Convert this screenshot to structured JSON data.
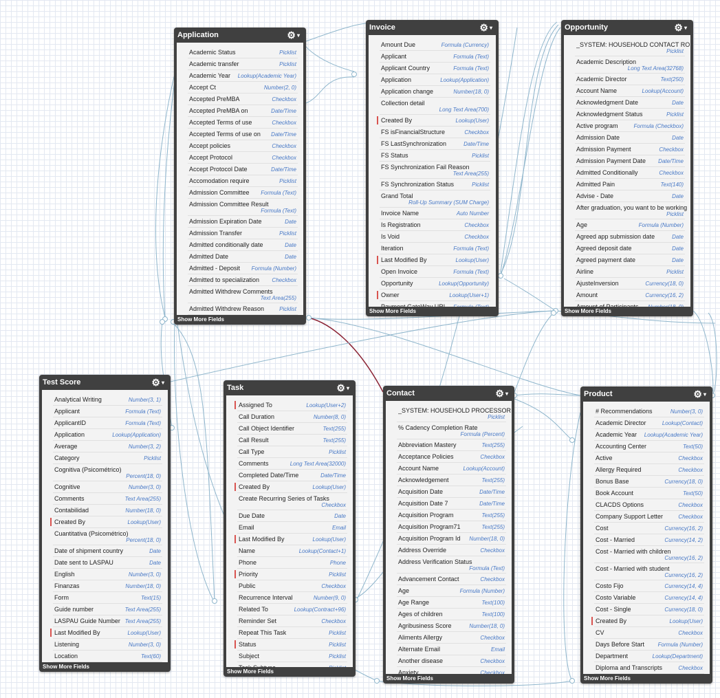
{
  "ui": {
    "gear_glyph": "⚙",
    "caret_glyph": "▾",
    "show_more": "Show More Fields"
  },
  "colors": {
    "header": "#404040",
    "body": "#f3f3f3",
    "field_type": "#4778c6",
    "lookup_marker": "#d9534f",
    "relation_line": "#8fb6cc",
    "master_detail_line": "#8a2233"
  },
  "objects": [
    {
      "id": "application",
      "title": "Application",
      "fields": [
        {
          "name": "Academic Status",
          "type": "Picklist"
        },
        {
          "name": "Academic transfer",
          "type": "Picklist"
        },
        {
          "name": "Academic Year",
          "type": "Lookup(Academic Year)"
        },
        {
          "name": "Accept Ct",
          "type": "Number(2, 0)"
        },
        {
          "name": "Accepted PreMBA",
          "type": "Checkbox"
        },
        {
          "name": "Accepted PreMBA on",
          "type": "Date/Time"
        },
        {
          "name": "Accepted Terms of use",
          "type": "Checkbox"
        },
        {
          "name": "Accepted Terms of use on",
          "type": "Date/Time"
        },
        {
          "name": "Accept policies",
          "type": "Checkbox"
        },
        {
          "name": "Accept Protocol",
          "type": "Checkbox"
        },
        {
          "name": "Accept Protocol Date",
          "type": "Date/Time"
        },
        {
          "name": "Accomodation require",
          "type": "Picklist"
        },
        {
          "name": "Admission Committee",
          "type": "Formula (Text)"
        },
        {
          "name": "Admission Committee Result",
          "type": "Formula (Text)",
          "wrap": true
        },
        {
          "name": "Admission Expiration Date",
          "type": "Date"
        },
        {
          "name": "Admission Transfer",
          "type": "Picklist"
        },
        {
          "name": "Admitted conditionally date",
          "type": "Date"
        },
        {
          "name": "Admitted Date",
          "type": "Date"
        },
        {
          "name": "Admitted - Deposit",
          "type": "Formula (Number)"
        },
        {
          "name": "Admitted to specialization",
          "type": "Checkbox"
        },
        {
          "name": "Admitted Withdrew Comments",
          "type": "Text Area(255)",
          "wrap": true
        },
        {
          "name": "Admitted Withdrew Reason",
          "type": "Picklist"
        }
      ]
    },
    {
      "id": "invoice",
      "title": "Invoice",
      "fields": [
        {
          "name": "Amount Due",
          "type": "Formula (Currency)"
        },
        {
          "name": "Applicant",
          "type": "Formula (Text)"
        },
        {
          "name": "Applicant Country",
          "type": "Formula (Text)"
        },
        {
          "name": "Application",
          "type": "Lookup(Application)"
        },
        {
          "name": "Application change",
          "type": "Number(18, 0)"
        },
        {
          "name": "Collection detail",
          "type": "Long Text Area(700)",
          "wrap": true
        },
        {
          "name": "Created By",
          "type": "Lookup(User)",
          "lookup": true
        },
        {
          "name": "FS isFinancialStructure",
          "type": "Checkbox"
        },
        {
          "name": "FS LastSynchronization",
          "type": "Date/Time"
        },
        {
          "name": "FS Status",
          "type": "Picklist"
        },
        {
          "name": "FS Synchronization Fail Reason",
          "type": "Text Area(255)",
          "wrap": true
        },
        {
          "name": "FS Synchronization Status",
          "type": "Picklist"
        },
        {
          "name": "Grand Total",
          "type": "Roll-Up Summary (SUM Charge)",
          "wrap": true
        },
        {
          "name": "Invoice Name",
          "type": "Auto Number"
        },
        {
          "name": "Is Registration",
          "type": "Checkbox"
        },
        {
          "name": "Is Void",
          "type": "Checkbox"
        },
        {
          "name": "Iteration",
          "type": "Formula (Text)"
        },
        {
          "name": "Last Modified By",
          "type": "Lookup(User)",
          "lookup": true
        },
        {
          "name": "Open Invoice",
          "type": "Formula (Text)"
        },
        {
          "name": "Opportunity",
          "type": "Lookup(Opportunity)"
        },
        {
          "name": "Owner",
          "type": "Lookup(User+1)",
          "lookup": true
        },
        {
          "name": "Payment GateWay URL",
          "type": "Formula (Text)"
        }
      ]
    },
    {
      "id": "opportunity",
      "title": "Opportunity",
      "fields": [
        {
          "name": "_SYSTEM: HOUSEHOLD CONTACT RO",
          "type": "Picklist",
          "wrap": true
        },
        {
          "name": "Academic Description",
          "type": "Long Text Area(32768)",
          "wrap": true
        },
        {
          "name": "Academic Director",
          "type": "Text(250)"
        },
        {
          "name": "Account Name",
          "type": "Lookup(Account)"
        },
        {
          "name": "Acknowledgment Date",
          "type": "Date"
        },
        {
          "name": "Acknowledgment Status",
          "type": "Picklist"
        },
        {
          "name": "Active program",
          "type": "Formula (Checkbox)"
        },
        {
          "name": "Admission Date",
          "type": "Date"
        },
        {
          "name": "Admission Payment",
          "type": "Checkbox"
        },
        {
          "name": "Admission Payment Date",
          "type": "Date/Time"
        },
        {
          "name": "Admitted Conditionally",
          "type": "Checkbox"
        },
        {
          "name": "Admitted Pain",
          "type": "Text(140)"
        },
        {
          "name": "Advise - Date",
          "type": "Date"
        },
        {
          "name": "After graduation, you want to be working",
          "type": "Picklist",
          "wrap": true
        },
        {
          "name": "Age",
          "type": "Formula (Number)"
        },
        {
          "name": "Agreed app submission date",
          "type": "Date"
        },
        {
          "name": "Agreed deposit date",
          "type": "Date"
        },
        {
          "name": "Agreed payment date",
          "type": "Date"
        },
        {
          "name": "Airline",
          "type": "Picklist"
        },
        {
          "name": "AjusteInversion",
          "type": "Currency(18, 0)"
        },
        {
          "name": "Amount",
          "type": "Currency(16, 2)"
        },
        {
          "name": "Amount of Participants",
          "type": "Number(18, 0)"
        }
      ]
    },
    {
      "id": "testscore",
      "title": "Test Score",
      "fields": [
        {
          "name": "Analytical Writing",
          "type": "Number(3, 1)"
        },
        {
          "name": "Applicant",
          "type": "Formula (Text)"
        },
        {
          "name": "ApplicantID",
          "type": "Formula (Text)"
        },
        {
          "name": "Application",
          "type": "Lookup(Application)"
        },
        {
          "name": "Average",
          "type": "Number(3, 2)"
        },
        {
          "name": "Category",
          "type": "Picklist"
        },
        {
          "name": "Cognitiva (Psicométrico)",
          "type": "Percent(18, 0)",
          "wrap": true
        },
        {
          "name": "Cognitive",
          "type": "Number(3, 0)"
        },
        {
          "name": "Comments",
          "type": "Text Area(255)"
        },
        {
          "name": "Contabilidad",
          "type": "Number(18, 0)"
        },
        {
          "name": "Created By",
          "type": "Lookup(User)",
          "lookup": true
        },
        {
          "name": "Cuantitativa (Psicométrico)",
          "type": "Percent(18, 0)",
          "wrap": true
        },
        {
          "name": "Date of shipment country",
          "type": "Date"
        },
        {
          "name": "Date sent to LASPAU",
          "type": "Date"
        },
        {
          "name": "English",
          "type": "Number(3, 0)"
        },
        {
          "name": "Finanzas",
          "type": "Number(18, 0)"
        },
        {
          "name": "Form",
          "type": "Text(15)"
        },
        {
          "name": "Guide number",
          "type": "Text Area(255)"
        },
        {
          "name": "LASPAU Guide Number",
          "type": "Text Area(255)"
        },
        {
          "name": "Last Modified By",
          "type": "Lookup(User)",
          "lookup": true
        },
        {
          "name": "Listening",
          "type": "Number(3, 0)"
        },
        {
          "name": "Location",
          "type": "Text(60)"
        }
      ]
    },
    {
      "id": "task",
      "title": "Task",
      "fields": [
        {
          "name": "Assigned To",
          "type": "Lookup(User+2)",
          "lookup": true
        },
        {
          "name": "Call Duration",
          "type": "Number(8, 0)"
        },
        {
          "name": "Call Object Identifier",
          "type": "Text(255)"
        },
        {
          "name": "Call Result",
          "type": "Text(255)"
        },
        {
          "name": "Call Type",
          "type": "Picklist"
        },
        {
          "name": "Comments",
          "type": "Long Text Area(32000)"
        },
        {
          "name": "Completed Date/Time",
          "type": "Date/Time"
        },
        {
          "name": "Created By",
          "type": "Lookup(User)",
          "lookup": true
        },
        {
          "name": "Create Recurring Series of Tasks",
          "type": "Checkbox",
          "wrap": true
        },
        {
          "name": "Due Date",
          "type": "Date"
        },
        {
          "name": "Email",
          "type": "Email"
        },
        {
          "name": "Last Modified By",
          "type": "Lookup(User)",
          "lookup": true
        },
        {
          "name": "Name",
          "type": "Lookup(Contact+1)"
        },
        {
          "name": "Phone",
          "type": "Phone"
        },
        {
          "name": "Priority",
          "type": "Picklist",
          "lookup": true
        },
        {
          "name": "Public",
          "type": "Checkbox"
        },
        {
          "name": "Recurrence Interval",
          "type": "Number(9, 0)"
        },
        {
          "name": "Related To",
          "type": "Lookup(Contract+96)"
        },
        {
          "name": "Reminder Set",
          "type": "Checkbox"
        },
        {
          "name": "Repeat This Task",
          "type": "Picklist"
        },
        {
          "name": "Status",
          "type": "Picklist",
          "lookup": true
        },
        {
          "name": "Subject",
          "type": "Picklist"
        },
        {
          "name": "Task Subtype",
          "type": "Picklist"
        }
      ]
    },
    {
      "id": "contact",
      "title": "Contact",
      "fields": [
        {
          "name": "_SYSTEM: HOUSEHOLD PROCESSOR",
          "type": "Picklist",
          "wrap": true
        },
        {
          "name": "% Cadency Completion Rate",
          "type": "Formula (Percent)",
          "wrap": true
        },
        {
          "name": "Abbreviation Mastery",
          "type": "Text(255)"
        },
        {
          "name": "Acceptance Policies",
          "type": "Checkbox"
        },
        {
          "name": "Account Name",
          "type": "Lookup(Account)"
        },
        {
          "name": "Acknowledgement",
          "type": "Text(255)"
        },
        {
          "name": "Acquisition Date",
          "type": "Date/Time"
        },
        {
          "name": "Acquisition Date 7",
          "type": "Date/Time"
        },
        {
          "name": "Acquisition Program",
          "type": "Text(255)"
        },
        {
          "name": "Acquisition Program71",
          "type": "Text(255)"
        },
        {
          "name": "Acquisition Program Id",
          "type": "Number(18, 0)"
        },
        {
          "name": "Address Override",
          "type": "Checkbox"
        },
        {
          "name": "Address Verification Status",
          "type": "Formula (Text)",
          "wrap": true
        },
        {
          "name": "Advancement Contact",
          "type": "Checkbox"
        },
        {
          "name": "Age",
          "type": "Formula (Number)"
        },
        {
          "name": "Age Range",
          "type": "Text(100)"
        },
        {
          "name": "Ages of children",
          "type": "Text(100)"
        },
        {
          "name": "Agribusiness Score",
          "type": "Number(18, 0)"
        },
        {
          "name": "Aliments Allergy",
          "type": "Checkbox"
        },
        {
          "name": "Alternate Email",
          "type": "Email"
        },
        {
          "name": "Another disease",
          "type": "Checkbox"
        },
        {
          "name": "Anxiety",
          "type": "Checkbox"
        }
      ]
    },
    {
      "id": "product",
      "title": "Product",
      "fields": [
        {
          "name": "# Recommendations",
          "type": "Number(3, 0)"
        },
        {
          "name": "Academic Director",
          "type": "Lookup(Contact)"
        },
        {
          "name": "Academic Year",
          "type": "Lookup(Academic Year)"
        },
        {
          "name": "Accounting Center",
          "type": "Text(50)"
        },
        {
          "name": "Active",
          "type": "Checkbox"
        },
        {
          "name": "Allergy Required",
          "type": "Checkbox"
        },
        {
          "name": "Bonus Base",
          "type": "Currency(18, 0)"
        },
        {
          "name": "Book Account",
          "type": "Text(50)"
        },
        {
          "name": "CLACDS Options",
          "type": "Checkbox"
        },
        {
          "name": "Company Support Letter",
          "type": "Checkbox"
        },
        {
          "name": "Cost",
          "type": "Currency(16, 2)"
        },
        {
          "name": "Cost - Married",
          "type": "Currency(14, 2)"
        },
        {
          "name": "Cost - Married with children",
          "type": "Currency(16, 2)",
          "wrap": true
        },
        {
          "name": "Cost - Married with student",
          "type": "Currency(16, 2)",
          "wrap": true
        },
        {
          "name": "Costo Fijo",
          "type": "Currency(14, 4)"
        },
        {
          "name": "Costo Variable",
          "type": "Currency(14, 4)"
        },
        {
          "name": "Cost - Single",
          "type": "Currency(18, 0)"
        },
        {
          "name": "Created By",
          "type": "Lookup(User)",
          "lookup": true
        },
        {
          "name": "CV",
          "type": "Checkbox"
        },
        {
          "name": "Days Before Start",
          "type": "Formula (Number)"
        },
        {
          "name": "Department",
          "type": "Lookup(Department)"
        },
        {
          "name": "Diploma and Transcripts",
          "type": "Checkbox"
        }
      ]
    }
  ]
}
